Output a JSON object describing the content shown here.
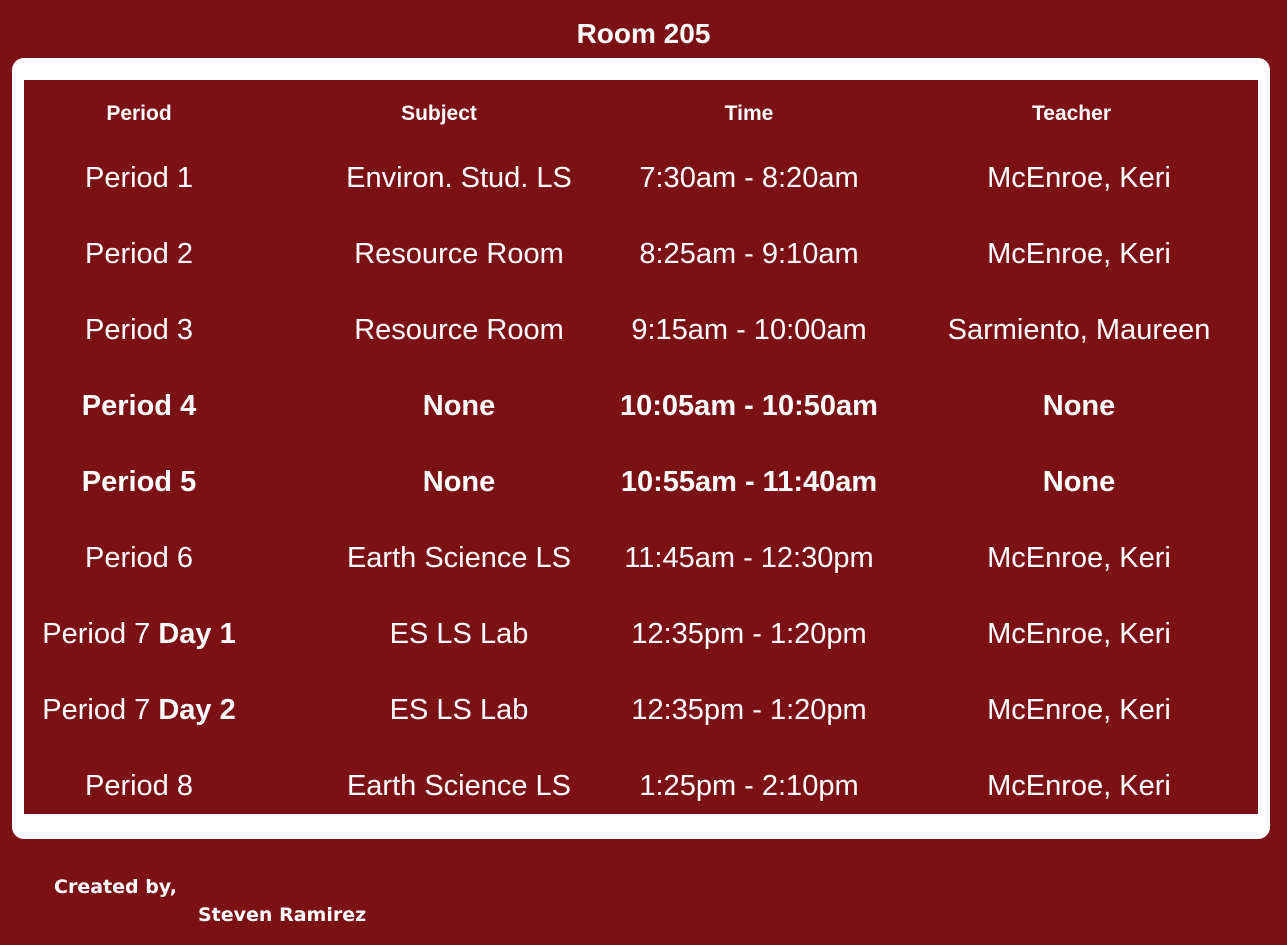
{
  "title": "Room 205",
  "headers": {
    "period": "Period",
    "subject": "Subject",
    "time": "Time",
    "teacher": "Teacher"
  },
  "rows": [
    {
      "period": "Period 1",
      "day": "",
      "subject": "Environ. Stud. LS",
      "time": "7:30am - 8:20am",
      "teacher": "McEnroe, Keri",
      "bold": false
    },
    {
      "period": "Period 2",
      "day": "",
      "subject": "Resource Room",
      "time": "8:25am - 9:10am",
      "teacher": "McEnroe, Keri",
      "bold": false
    },
    {
      "period": "Period 3",
      "day": "",
      "subject": "Resource Room",
      "time": "9:15am - 10:00am",
      "teacher": "Sarmiento, Maureen",
      "bold": false
    },
    {
      "period": "Period 4",
      "day": "",
      "subject": "None",
      "time": "10:05am - 10:50am",
      "teacher": "None",
      "bold": true
    },
    {
      "period": "Period 5",
      "day": "",
      "subject": "None",
      "time": "10:55am - 11:40am",
      "teacher": "None",
      "bold": true
    },
    {
      "period": "Period 6",
      "day": "",
      "subject": "Earth Science LS",
      "time": "11:45am - 12:30pm",
      "teacher": "McEnroe,  Keri",
      "bold": false
    },
    {
      "period": "Period 7",
      "day": "Day 1",
      "subject": "ES LS Lab",
      "time": "12:35pm - 1:20pm",
      "teacher": "McEnroe, Keri",
      "bold": false
    },
    {
      "period": "Period 7",
      "day": "Day 2",
      "subject": "ES LS Lab",
      "time": "12:35pm - 1:20pm",
      "teacher": "McEnroe, Keri",
      "bold": false
    },
    {
      "period": "Period 8",
      "day": "",
      "subject": "Earth Science LS",
      "time": "1:25pm - 2:10pm",
      "teacher": "McEnroe, Keri",
      "bold": false
    }
  ],
  "credits": {
    "line1": "Created by,",
    "line2": "Steven Ramirez"
  },
  "colors": {
    "background": "#7b1115",
    "frame": "#ffffff",
    "text": "#ffffff"
  }
}
